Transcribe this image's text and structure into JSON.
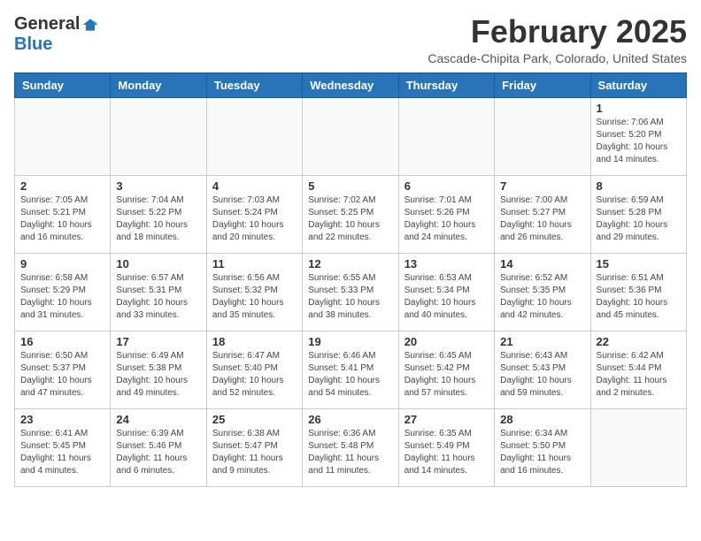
{
  "header": {
    "logo_general": "General",
    "logo_blue": "Blue",
    "month_title": "February 2025",
    "location": "Cascade-Chipita Park, Colorado, United States"
  },
  "days_of_week": [
    "Sunday",
    "Monday",
    "Tuesday",
    "Wednesday",
    "Thursday",
    "Friday",
    "Saturday"
  ],
  "weeks": [
    [
      {
        "day": "",
        "info": ""
      },
      {
        "day": "",
        "info": ""
      },
      {
        "day": "",
        "info": ""
      },
      {
        "day": "",
        "info": ""
      },
      {
        "day": "",
        "info": ""
      },
      {
        "day": "",
        "info": ""
      },
      {
        "day": "1",
        "info": "Sunrise: 7:06 AM\nSunset: 5:20 PM\nDaylight: 10 hours\nand 14 minutes."
      }
    ],
    [
      {
        "day": "2",
        "info": "Sunrise: 7:05 AM\nSunset: 5:21 PM\nDaylight: 10 hours\nand 16 minutes."
      },
      {
        "day": "3",
        "info": "Sunrise: 7:04 AM\nSunset: 5:22 PM\nDaylight: 10 hours\nand 18 minutes."
      },
      {
        "day": "4",
        "info": "Sunrise: 7:03 AM\nSunset: 5:24 PM\nDaylight: 10 hours\nand 20 minutes."
      },
      {
        "day": "5",
        "info": "Sunrise: 7:02 AM\nSunset: 5:25 PM\nDaylight: 10 hours\nand 22 minutes."
      },
      {
        "day": "6",
        "info": "Sunrise: 7:01 AM\nSunset: 5:26 PM\nDaylight: 10 hours\nand 24 minutes."
      },
      {
        "day": "7",
        "info": "Sunrise: 7:00 AM\nSunset: 5:27 PM\nDaylight: 10 hours\nand 26 minutes."
      },
      {
        "day": "8",
        "info": "Sunrise: 6:59 AM\nSunset: 5:28 PM\nDaylight: 10 hours\nand 29 minutes."
      }
    ],
    [
      {
        "day": "9",
        "info": "Sunrise: 6:58 AM\nSunset: 5:29 PM\nDaylight: 10 hours\nand 31 minutes."
      },
      {
        "day": "10",
        "info": "Sunrise: 6:57 AM\nSunset: 5:31 PM\nDaylight: 10 hours\nand 33 minutes."
      },
      {
        "day": "11",
        "info": "Sunrise: 6:56 AM\nSunset: 5:32 PM\nDaylight: 10 hours\nand 35 minutes."
      },
      {
        "day": "12",
        "info": "Sunrise: 6:55 AM\nSunset: 5:33 PM\nDaylight: 10 hours\nand 38 minutes."
      },
      {
        "day": "13",
        "info": "Sunrise: 6:53 AM\nSunset: 5:34 PM\nDaylight: 10 hours\nand 40 minutes."
      },
      {
        "day": "14",
        "info": "Sunrise: 6:52 AM\nSunset: 5:35 PM\nDaylight: 10 hours\nand 42 minutes."
      },
      {
        "day": "15",
        "info": "Sunrise: 6:51 AM\nSunset: 5:36 PM\nDaylight: 10 hours\nand 45 minutes."
      }
    ],
    [
      {
        "day": "16",
        "info": "Sunrise: 6:50 AM\nSunset: 5:37 PM\nDaylight: 10 hours\nand 47 minutes."
      },
      {
        "day": "17",
        "info": "Sunrise: 6:49 AM\nSunset: 5:38 PM\nDaylight: 10 hours\nand 49 minutes."
      },
      {
        "day": "18",
        "info": "Sunrise: 6:47 AM\nSunset: 5:40 PM\nDaylight: 10 hours\nand 52 minutes."
      },
      {
        "day": "19",
        "info": "Sunrise: 6:46 AM\nSunset: 5:41 PM\nDaylight: 10 hours\nand 54 minutes."
      },
      {
        "day": "20",
        "info": "Sunrise: 6:45 AM\nSunset: 5:42 PM\nDaylight: 10 hours\nand 57 minutes."
      },
      {
        "day": "21",
        "info": "Sunrise: 6:43 AM\nSunset: 5:43 PM\nDaylight: 10 hours\nand 59 minutes."
      },
      {
        "day": "22",
        "info": "Sunrise: 6:42 AM\nSunset: 5:44 PM\nDaylight: 11 hours\nand 2 minutes."
      }
    ],
    [
      {
        "day": "23",
        "info": "Sunrise: 6:41 AM\nSunset: 5:45 PM\nDaylight: 11 hours\nand 4 minutes."
      },
      {
        "day": "24",
        "info": "Sunrise: 6:39 AM\nSunset: 5:46 PM\nDaylight: 11 hours\nand 6 minutes."
      },
      {
        "day": "25",
        "info": "Sunrise: 6:38 AM\nSunset: 5:47 PM\nDaylight: 11 hours\nand 9 minutes."
      },
      {
        "day": "26",
        "info": "Sunrise: 6:36 AM\nSunset: 5:48 PM\nDaylight: 11 hours\nand 11 minutes."
      },
      {
        "day": "27",
        "info": "Sunrise: 6:35 AM\nSunset: 5:49 PM\nDaylight: 11 hours\nand 14 minutes."
      },
      {
        "day": "28",
        "info": "Sunrise: 6:34 AM\nSunset: 5:50 PM\nDaylight: 11 hours\nand 16 minutes."
      },
      {
        "day": "",
        "info": ""
      }
    ]
  ]
}
